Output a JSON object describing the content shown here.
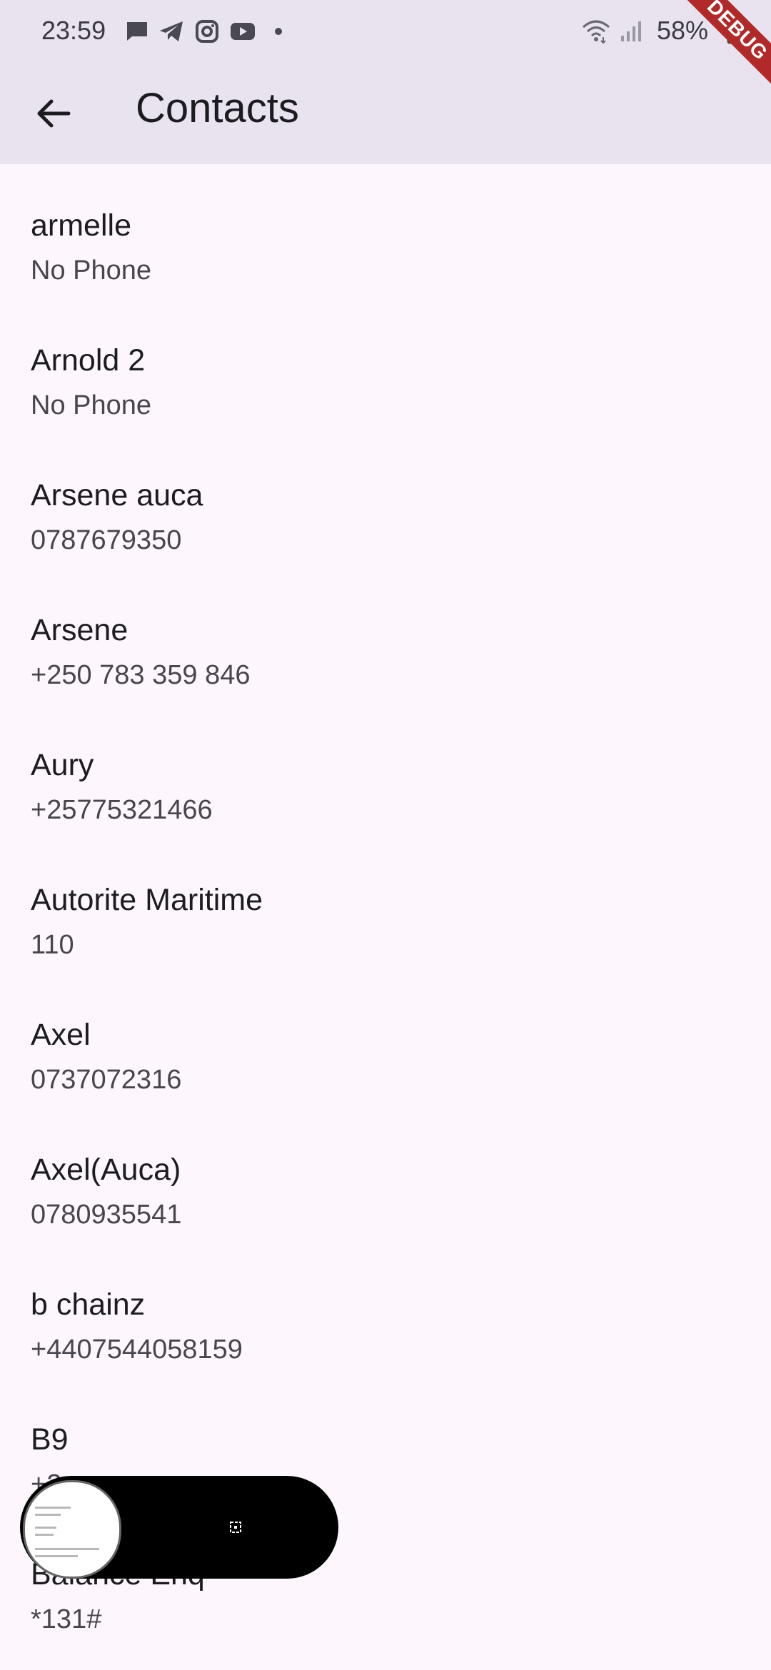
{
  "status_bar": {
    "time": "23:59",
    "battery": "58%",
    "notification_icons": [
      "message-icon",
      "telegram-icon",
      "instagram-icon",
      "youtube-icon",
      "dot-icon"
    ],
    "system_icons": [
      "wifi-icon",
      "signal-icon",
      "battery-icon"
    ]
  },
  "debug_banner": "DEBUG",
  "app_bar": {
    "title": "Contacts",
    "back_icon": "arrow-back-icon"
  },
  "contacts": [
    {
      "name": "armelle",
      "phone": "No Phone"
    },
    {
      "name": "Arnold 2",
      "phone": "No Phone"
    },
    {
      "name": "Arsene auca",
      "phone": "0787679350"
    },
    {
      "name": "Arsene",
      "phone": "+250 783 359 846"
    },
    {
      "name": "Aury",
      "phone": "+25775321466"
    },
    {
      "name": "Autorite Maritime",
      "phone": "110"
    },
    {
      "name": "Axel",
      "phone": "0737072316"
    },
    {
      "name": "Axel(Auca)",
      "phone": "0780935541"
    },
    {
      "name": "b chainz",
      "phone": "+4407544058159"
    },
    {
      "name": "B9",
      "phone": "+2"
    },
    {
      "name": "Balance Enq",
      "phone": "*131#"
    }
  ],
  "colors": {
    "appbar_bg": "#e9e2ef",
    "page_bg": "#fdf7fd",
    "primary_text": "#1c1b1f",
    "secondary_text": "#49454f",
    "debug_ribbon": "#b02a2a"
  }
}
